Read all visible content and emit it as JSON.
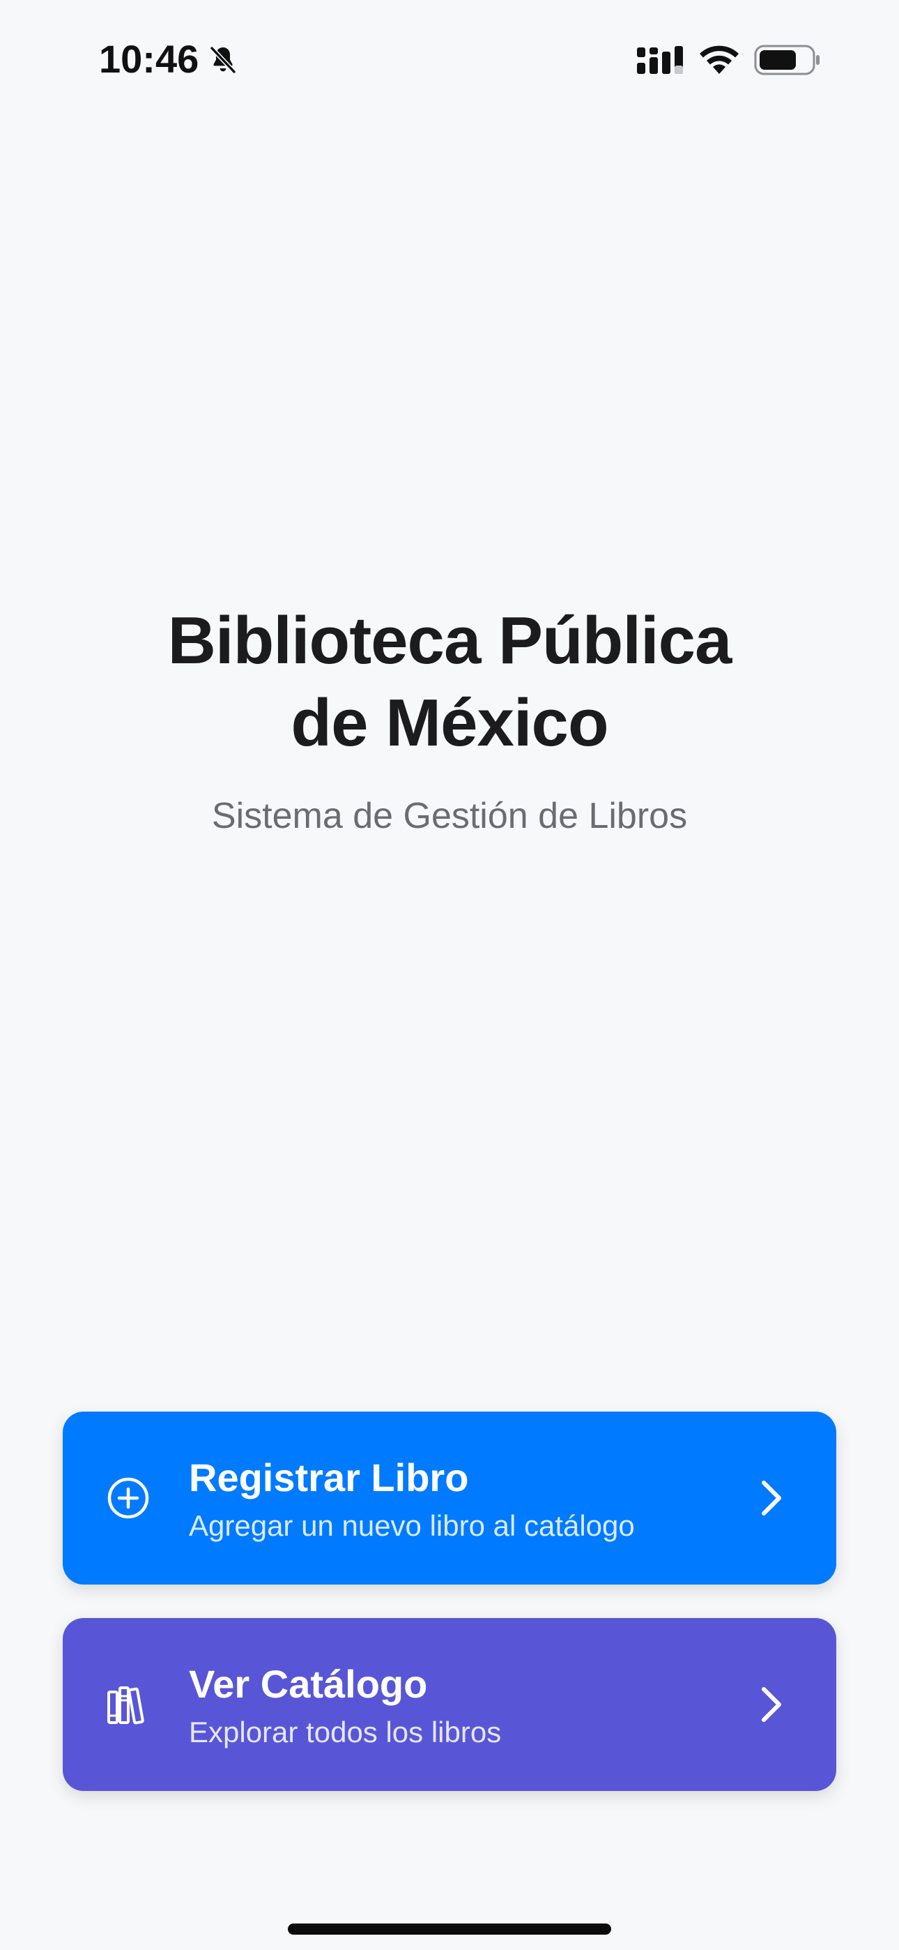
{
  "status_bar": {
    "time": "10:46",
    "icons": [
      "bell-slash-icon",
      "cellular-signal-icon",
      "wifi-icon",
      "battery-icon"
    ]
  },
  "hero": {
    "title_line1": "Biblioteca Pública",
    "title_line2": "de México",
    "subtitle": "Sistema de Gestión de Libros"
  },
  "actions": [
    {
      "title": "Registrar Libro",
      "description": "Agregar un nuevo libro al catálogo",
      "icon": "plus-circle-icon",
      "color": "#007AFF"
    },
    {
      "title": "Ver Catálogo",
      "description": "Explorar todos los libros",
      "icon": "books-icon",
      "color": "#5856D6"
    }
  ],
  "colors": {
    "background": "#F7F8FA",
    "title": "#1C1C1E",
    "subtitle": "#6C6C70"
  }
}
